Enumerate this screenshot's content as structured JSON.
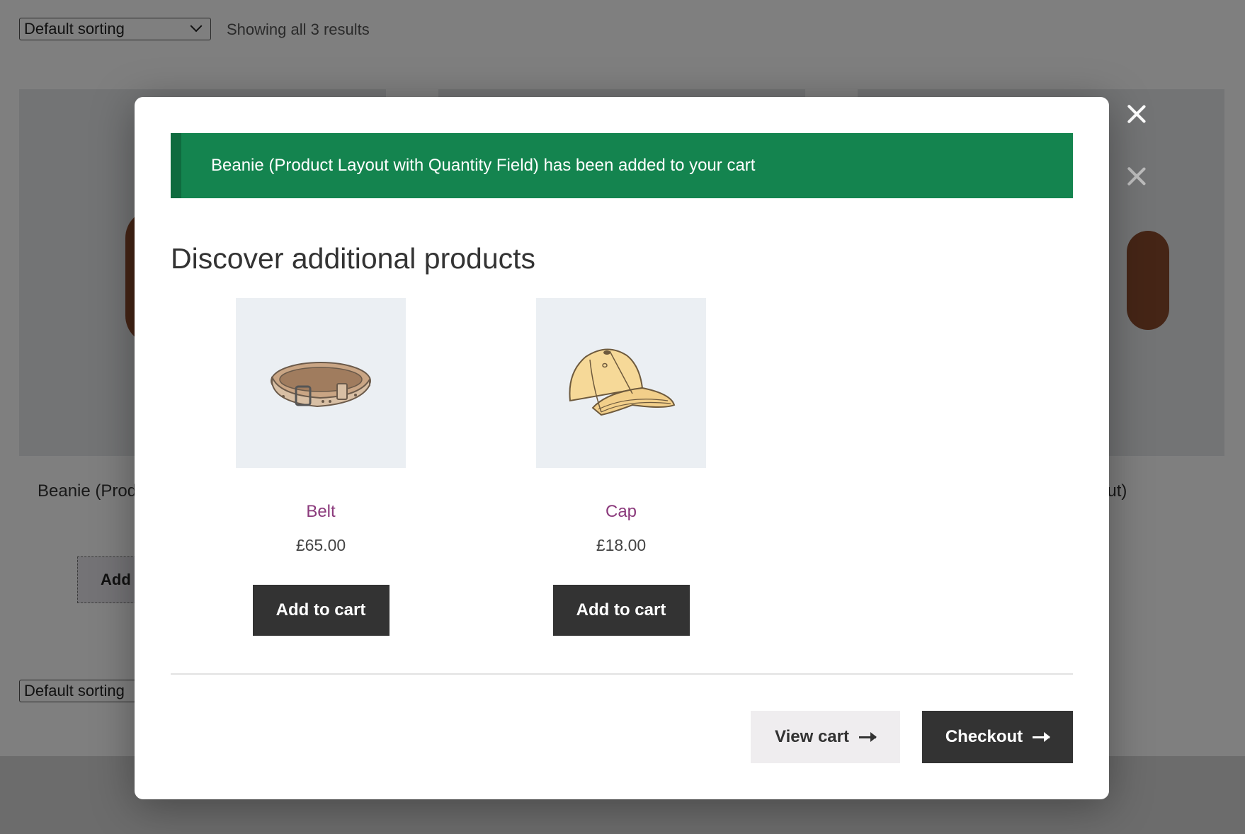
{
  "shop": {
    "sort_label": "Default sorting",
    "result_count": "Showing all 3 results",
    "bottom_sort_label": "Default sorting",
    "bg_product_title_left": "Beanie (Prod",
    "bg_product_title_right": "out)",
    "bg_add_button": "Add t"
  },
  "modal": {
    "notice": "Beanie (Product Layout with Quantity Field) has been added to your cart",
    "heading": "Discover additional products",
    "products": [
      {
        "name": "Belt",
        "price": "£65.00",
        "button": "Add to cart",
        "image_icon": "belt-icon"
      },
      {
        "name": "Cap",
        "price": "£18.00",
        "button": "Add to cart",
        "image_icon": "cap-icon"
      }
    ],
    "view_cart_label": "View cart",
    "checkout_label": "Checkout"
  },
  "colors": {
    "notice_bg": "#14844f",
    "button_dark": "#333333",
    "link_purple": "#8b3a7c",
    "thumb_bg": "#ebeff3"
  }
}
